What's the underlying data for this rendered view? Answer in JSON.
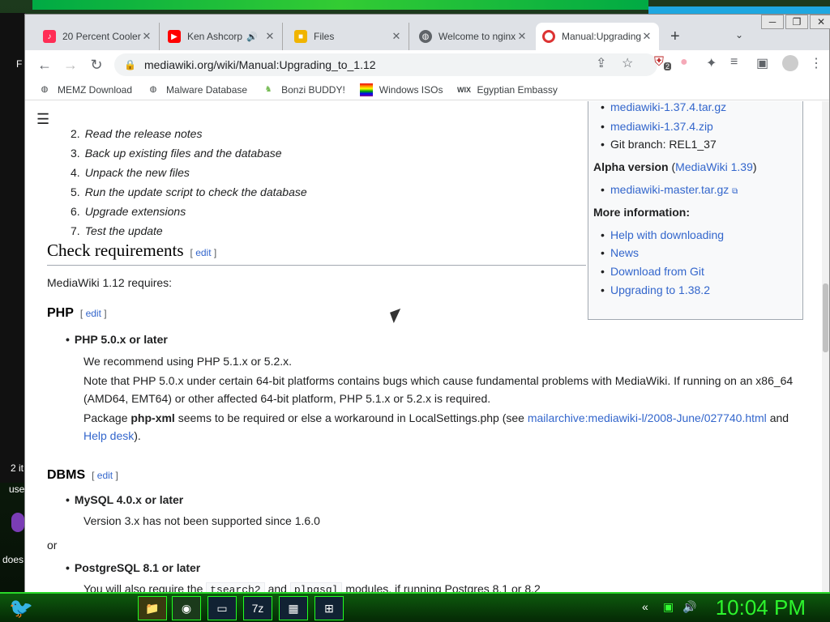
{
  "desktop": {
    "left_labels": [
      "F",
      "2 it",
      "use",
      "does"
    ]
  },
  "tabs": [
    {
      "title": "20 Percent Cooler",
      "icon": "music-icon",
      "color": "#ff2d55"
    },
    {
      "title": "Ken Ashcorp",
      "icon": "youtube-icon",
      "color": "#ff0000"
    },
    {
      "title": "Files",
      "icon": "folder-icon",
      "color": "#f0b400"
    },
    {
      "title": "Welcome to nginx!",
      "icon": "globe-icon",
      "color": "#5f6368"
    },
    {
      "title": "Manual:Upgrading",
      "icon": "mediawiki-icon",
      "color": "#d33"
    }
  ],
  "toolbar": {
    "url": "mediawiki.org/wiki/Manual:Upgrading_to_1.12",
    "ext_badge": "2"
  },
  "bookmarks": [
    {
      "label": "MEMZ Download",
      "icon": "globe-icon"
    },
    {
      "label": "Malware Database",
      "icon": "globe-icon"
    },
    {
      "label": "Bonzi BUDDY!",
      "icon": "bonzi-icon"
    },
    {
      "label": "Windows ISOs",
      "icon": "rainbow-flag-icon"
    },
    {
      "label": "Egyptian Embassy",
      "icon": "wix-icon"
    }
  ],
  "steps": [
    {
      "n": "2.",
      "text": "Read the release notes"
    },
    {
      "n": "3.",
      "text": "Back up existing files and the database"
    },
    {
      "n": "4.",
      "text": "Unpack the new files"
    },
    {
      "n": "5.",
      "text": "Run the update script to check the database"
    },
    {
      "n": "6.",
      "text": "Upgrade extensions"
    },
    {
      "n": "7.",
      "text": "Test the update"
    }
  ],
  "infobox": {
    "top_links": [
      "mediawiki-1.37.4.tar.gz",
      "mediawiki-1.37.4.zip"
    ],
    "git_branch": "Git branch: REL1_37",
    "alpha_label": "Alpha version",
    "alpha_link": "MediaWiki 1.39",
    "alpha_file": "mediawiki-master.tar.gz",
    "more_info": "More information:",
    "more_links": [
      "Help with downloading",
      "News",
      "Download from Git",
      "Upgrading to 1.38.2"
    ]
  },
  "content": {
    "check_req_title": "Check requirements",
    "edit": "edit",
    "mw_requires": "MediaWiki 1.12 requires:",
    "php_title": "PHP",
    "php_bullet": "PHP 5.0.x or later",
    "php_rec": "We recommend using PHP 5.1.x or 5.2.x.",
    "php_note1": "Note that PHP 5.0.x under certain 64-bit platforms contains bugs which cause fundamental problems with MediaWiki. If running on an x86_64",
    "php_note2": "(AMD64, EMT64) or other affected 64-bit platform, PHP 5.1.x or 5.2.x is required.",
    "pkg_pre": "Package",
    "pkg_name": "php-xml",
    "pkg_mid": "seems to be required or else a workaround in LocalSettings.php (see",
    "pkg_link": "mailarchive:mediawiki-l/2008-June/027740.html",
    "pkg_and": "and",
    "pkg_help": "Help desk",
    "pkg_end": ").",
    "dbms_title": "DBMS",
    "mysql_bullet": "MySQL 4.0.x or later",
    "mysql_note": "Version 3.x has not been supported since 1.6.0",
    "or": "or",
    "pg_bullet": "PostgreSQL 8.1 or later",
    "pg_pre": "You will also require the",
    "pg_code1": "tsearch2",
    "pg_and": "and",
    "pg_code2": "plpgsql",
    "pg_post": "modules, if running Postgres 8.1 or 8.2"
  },
  "taskbar": {
    "clock": "10:04 PM"
  }
}
